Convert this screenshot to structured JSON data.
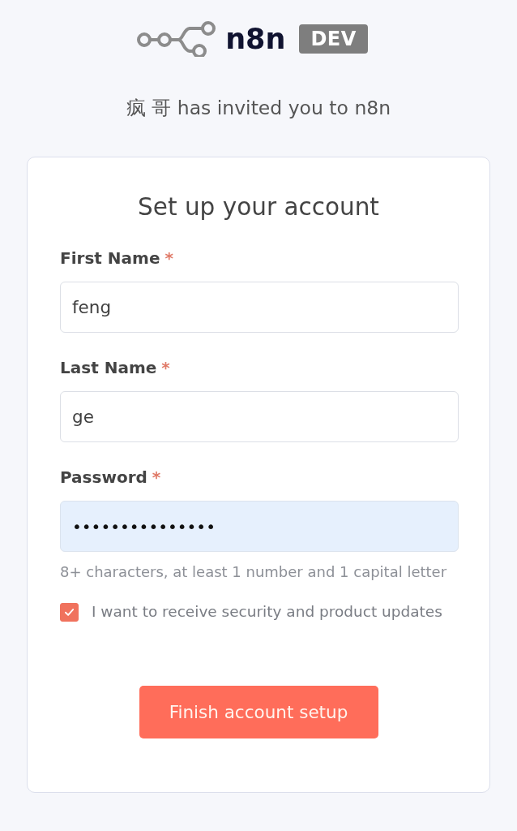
{
  "header": {
    "logo_text": "n8n",
    "badge": "DEV",
    "subtitle": "疯 哥 has invited you to n8n"
  },
  "card": {
    "title": "Set up your account",
    "fields": [
      {
        "label": "First Name",
        "required_mark": "*",
        "value": "feng",
        "autofilled": false
      },
      {
        "label": "Last Name",
        "required_mark": "*",
        "value": "ge",
        "autofilled": false
      },
      {
        "label": "Password",
        "required_mark": "*",
        "value": "•••••••••••••••",
        "autofilled": true
      }
    ],
    "hint": "8+ characters, at least 1 number and 1 capital letter",
    "checkbox": {
      "label": "I want to receive security and product updates",
      "checked": true
    },
    "button": "Finish account setup"
  }
}
